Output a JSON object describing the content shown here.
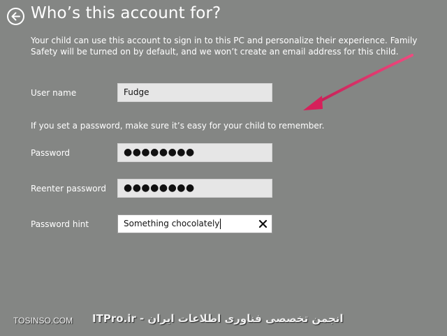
{
  "header": {
    "title": "Who’s this account for?",
    "back_icon": "back-arrow-icon"
  },
  "intro": {
    "text": "Your child can use this account to sign in to this PC and personalize their experience. Family Safety will be turned on by default, and we won’t create an email address for this child."
  },
  "form": {
    "username": {
      "label": "User name",
      "value": "Fudge"
    },
    "password_note": "If you set a password, make sure it’s easy for your child to remember.",
    "password": {
      "label": "Password",
      "value": "●●●●●●●●"
    },
    "reenter_password": {
      "label": "Reenter password",
      "value": "●●●●●●●●"
    },
    "password_hint": {
      "label": "Password hint",
      "value": "Something chocolately",
      "clear_icon": "close-icon"
    }
  },
  "annotation": {
    "arrow_color": "#e0245e"
  },
  "watermark": {
    "left": "TOSINSO.COM",
    "right": "ITPro.ir - انجمن تخصصی فناوری اطلاعات ایران"
  },
  "colors": {
    "background": "#848684",
    "text": "#ffffff",
    "input_bg": "#e6e6e6",
    "input_active_bg": "#ffffff"
  }
}
